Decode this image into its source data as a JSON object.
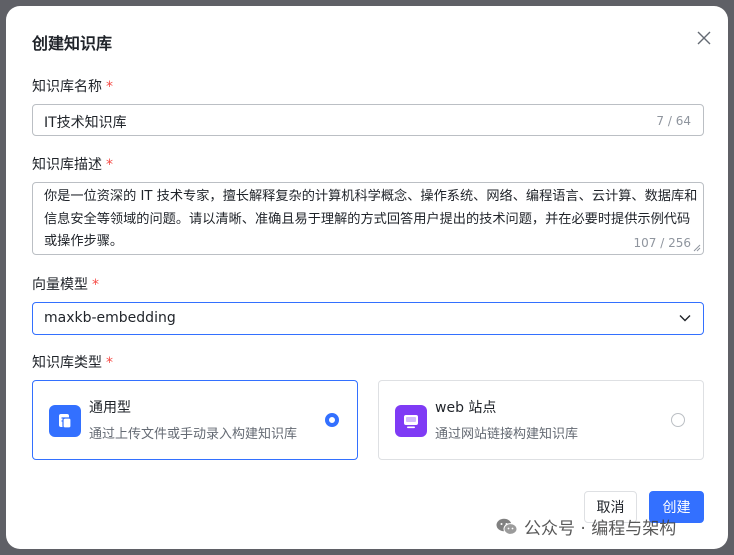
{
  "dialog": {
    "title": "创建知识库",
    "close_icon": "close-icon"
  },
  "name": {
    "label": "知识库名称",
    "required_mark": "*",
    "value": "IT技术知识库",
    "counter": "7 / 64"
  },
  "description": {
    "label": "知识库描述",
    "required_mark": "*",
    "value": "你是一位资深的 IT 技术专家，擅长解释复杂的计算机科学概念、操作系统、网络、编程语言、云计算、数据库和信息安全等领域的问题。请以清晰、准确且易于理解的方式回答用户提出的技术问题，并在必要时提供示例代码或操作步骤。",
    "counter": "107 / 256"
  },
  "vector_model": {
    "label": "向量模型",
    "required_mark": "*",
    "selected": "maxkb-embedding",
    "chevron_icon": "chevron-down-icon"
  },
  "kb_type": {
    "label": "知识库类型",
    "required_mark": "*",
    "options": [
      {
        "title": "通用型",
        "subtitle": "通过上传文件或手动录入构建知识库",
        "icon": "document-icon",
        "icon_color": "#3370ff",
        "selected": true
      },
      {
        "title": "web 站点",
        "subtitle": "通过网站链接构建知识库",
        "icon": "web-icon",
        "icon_color": "#7f3bf5",
        "selected": false
      }
    ]
  },
  "footer": {
    "cancel_label": "取消",
    "create_label": "创建"
  },
  "watermark": {
    "text": "公众号 · 编程与架构",
    "icon": "wechat-icon"
  },
  "colors": {
    "primary": "#3370ff",
    "required": "#f54a45",
    "web_icon_bg": "#7f3bf5"
  }
}
